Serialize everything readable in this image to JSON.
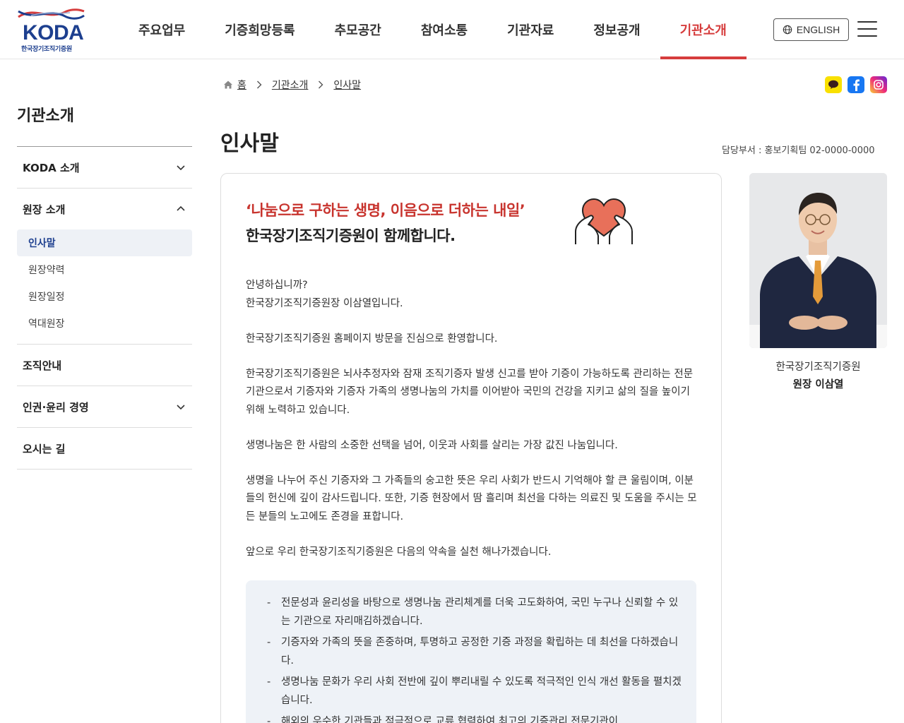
{
  "logo": {
    "brand": "KODA",
    "sub": "한국장기조직기증원"
  },
  "gnb": [
    "주요업무",
    "기증희망등록",
    "추모공간",
    "참여소통",
    "기관자료",
    "정보공개",
    "기관소개"
  ],
  "gnb_active_index": 6,
  "lang_button": "ENGLISH",
  "sidebar": {
    "title": "기관소개",
    "groups": [
      {
        "label": "KODA 소개",
        "expanded": false
      },
      {
        "label": "원장 소개",
        "expanded": true,
        "items": [
          "인사말",
          "원장약력",
          "원장일정",
          "역대원장"
        ],
        "active_item": "인사말"
      },
      {
        "label": "조직안내",
        "expanded": false
      },
      {
        "label": "인권·윤리 경영",
        "expanded": false
      },
      {
        "label": "오시는 길",
        "expanded": false
      }
    ]
  },
  "breadcrumb": [
    "홈",
    "기관소개",
    "인사말"
  ],
  "page_title": "인사말",
  "dept": "담당부서 : 홍보기획팀 02-0000-0000",
  "sns": [
    {
      "name": "kakao-icon",
      "color": "#f9e000"
    },
    {
      "name": "facebook-icon",
      "color": "#1877f2"
    },
    {
      "name": "instagram-icon",
      "color": "#d62976"
    }
  ],
  "content": {
    "quote": "‘나눔으로 구하는 생명, 이음으로 더하는 내일’",
    "headline": "한국장기조직기증원이 함께합니다.",
    "greeting_1": "안녕하십니까?",
    "greeting_2": "한국장기조직기증원장 이삼열입니다.",
    "paragraphs": [
      "한국장기조직기증원 홈페이지 방문을 진심으로 환영합니다.",
      "한국장기조직기증원은 뇌사추정자와 잠재 조직기증자 발생 신고를 받아 기증이 가능하도록 관리하는 전문기관으로서 기증자와 기증자 가족의 생명나눔의 가치를 이어받아 국민의 건강을 지키고 삶의 질을 높이기 위해 노력하고 있습니다.",
      "생명나눔은 한 사람의 소중한 선택을 넘어, 이웃과 사회를 살리는 가장 값진 나눔입니다.",
      "생명을 나누어 주신 기증자와 그 가족들의 숭고한 뜻은 우리 사회가 반드시 기억해야 할 큰 울림이며, 이분들의 헌신에 깊이 감사드립니다. 또한, 기증 현장에서 땀 흘리며 최선을 다하는 의료진 및 도움을 주시는 모든 분들의 노고에도 존경을 표합니다.",
      "앞으로 우리 한국장기조직기증원은 다음의 약속을 실천 해나가겠습니다."
    ],
    "promises": [
      "전문성과 윤리성을 바탕으로 생명나눔 관리체계를 더욱 고도화하여, 국민 누구나 신뢰할 수 있는 기관으로 자리매김하겠습니다.",
      "기증자와 가족의 뜻을 존중하며, 투명하고 공정한 기증 과정을 확립하는 데 최선을 다하겠습니다.",
      "생명나눔 문화가 우리 사회 전반에 깊이 뿌리내릴 수 있도록 적극적인 인식 개선 활동을 펼치겠습니다.",
      "해외의 우수한 기관들과 적극적으로 교류 협력하여 최고의 기증관리 전문기관이"
    ]
  },
  "photo_caption": {
    "org": "한국장기조직기증원",
    "name": "원장 이삼열"
  },
  "colors": {
    "accent": "#d63d3d",
    "brand": "#1d3f8f"
  }
}
